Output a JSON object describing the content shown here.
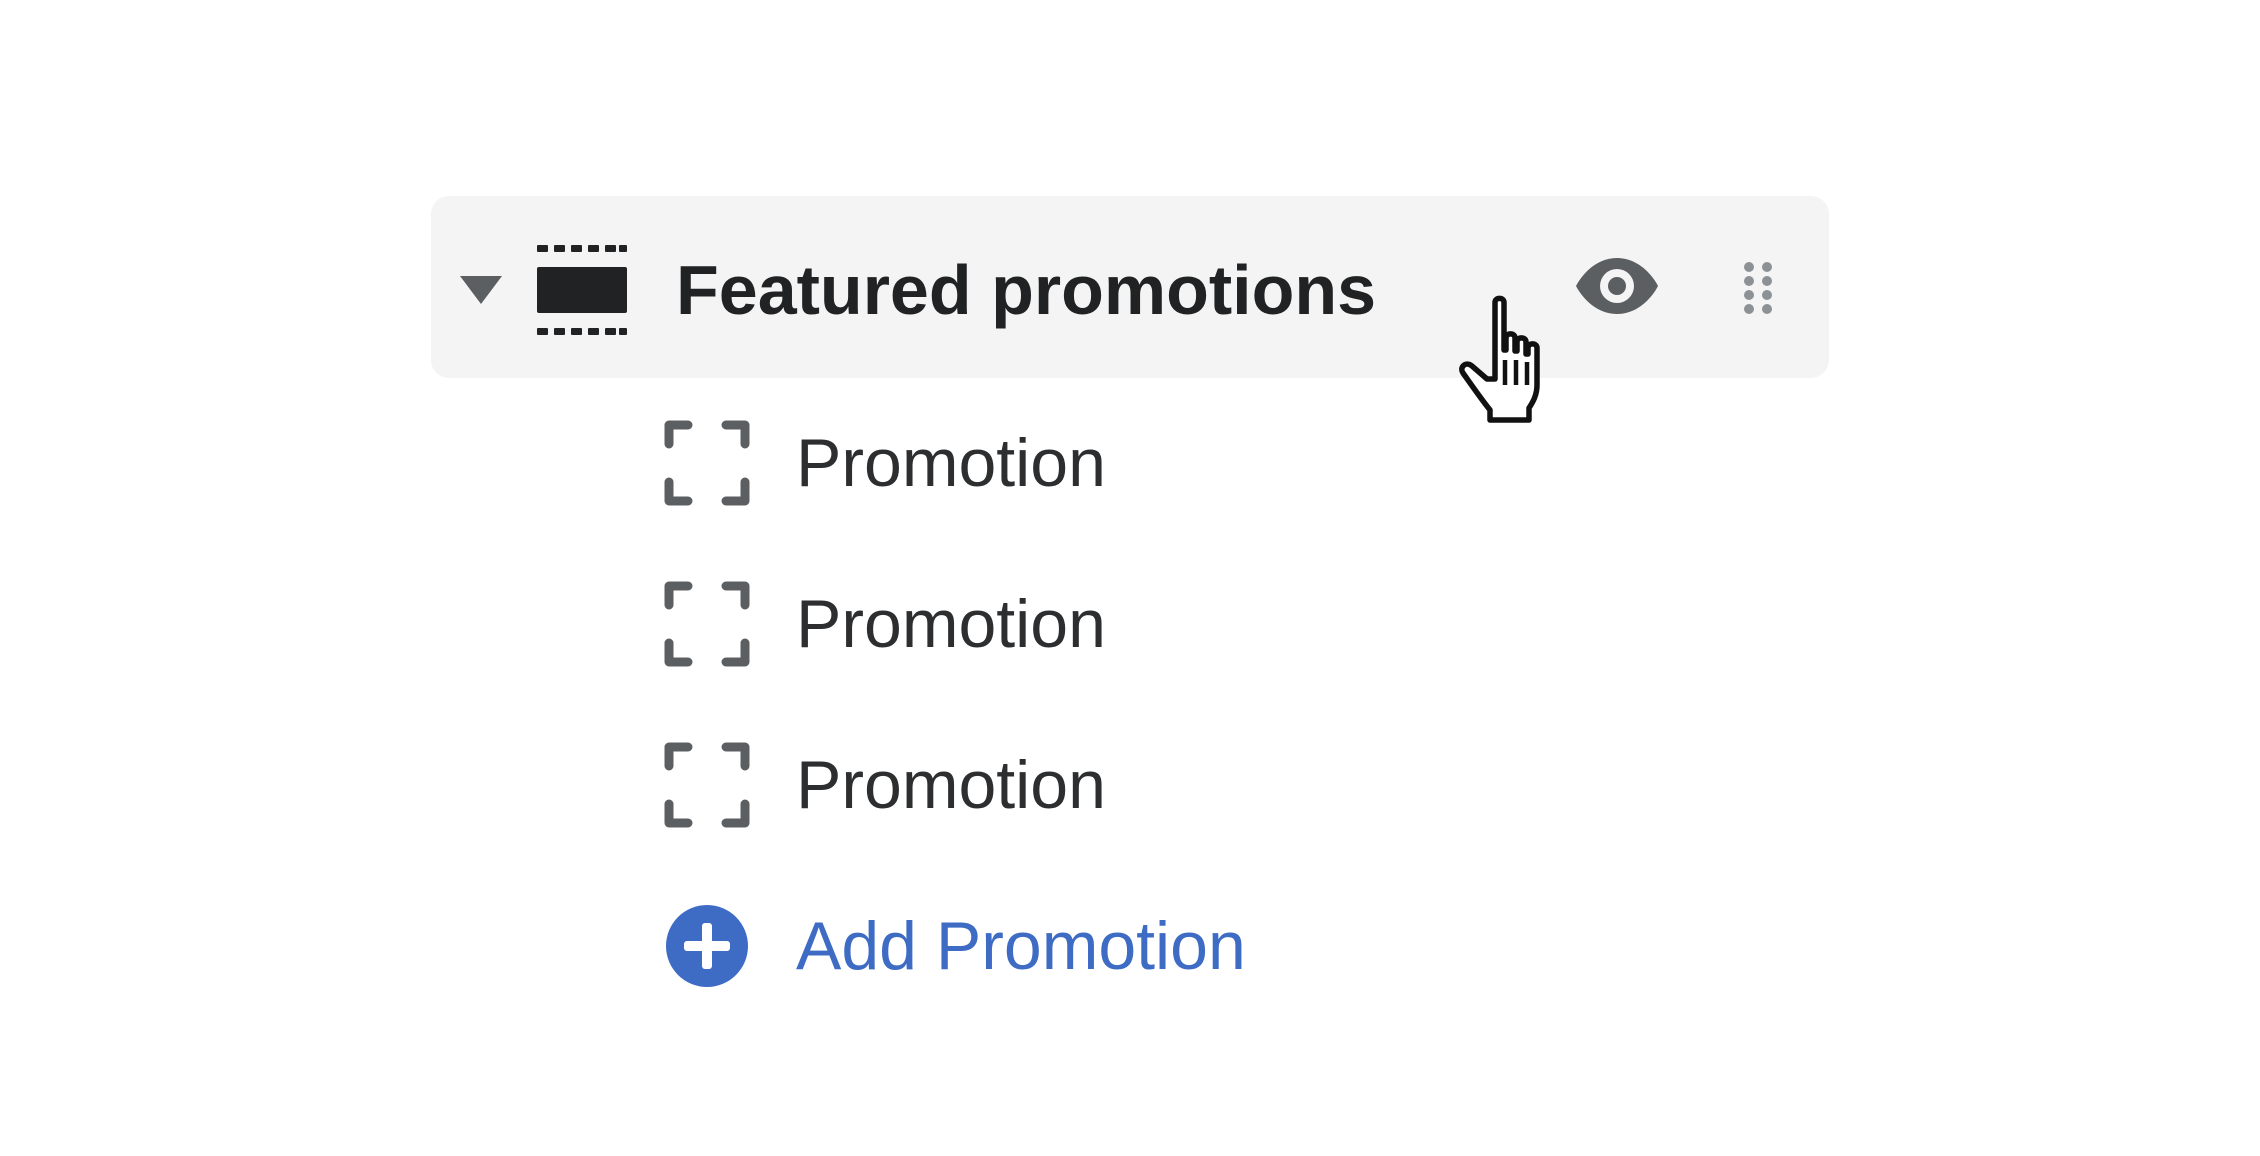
{
  "section": {
    "title": "Featured promotions",
    "icons": {
      "disclosure": "caret-down-icon",
      "section": "section-template-icon",
      "visibility": "eye-icon",
      "drag": "drag-handle-icon"
    }
  },
  "blocks": [
    {
      "label": "Promotion",
      "icon": "block-dashed-icon"
    },
    {
      "label": "Promotion",
      "icon": "block-dashed-icon"
    },
    {
      "label": "Promotion",
      "icon": "block-dashed-icon"
    }
  ],
  "add_block": {
    "label": "Add Promotion",
    "icon": "plus-circle-icon"
  },
  "colors": {
    "row_background": "#f4f4f4",
    "text": "#202223",
    "icon_gray": "#5c5f62",
    "accent_blue": "#3e6cc4"
  }
}
